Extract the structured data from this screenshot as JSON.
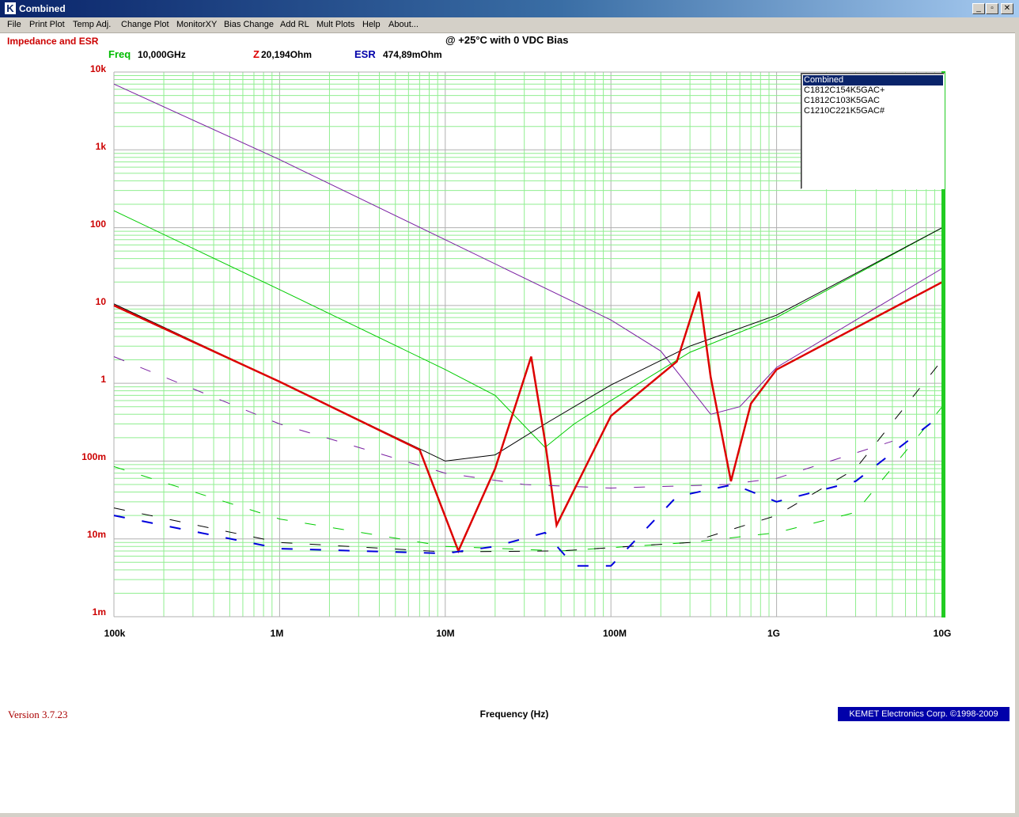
{
  "window": {
    "title": "Combined",
    "minimize": "_",
    "restore": "▫",
    "close": "✕"
  },
  "menu": [
    "File",
    "Print Plot",
    "Temp Adj.",
    "Change Plot",
    "MonitorXY",
    "Bias Change",
    "Add RL",
    "Mult Plots",
    "Help",
    "About..."
  ],
  "header": {
    "plot_title": "Impedance and ESR",
    "subtitle": "@ +25°C with 0 VDC Bias",
    "freq_label": "Freq",
    "freq_value": "10,000GHz",
    "z_label": "Z",
    "z_value": "20,194Ohm",
    "esr_label": "ESR",
    "esr_value": "474,89mOhm"
  },
  "legend": {
    "items": [
      "Combined",
      "C1812C154K5GAC+",
      "C1812C103K5GAC",
      "C1210C221K5GAC#"
    ],
    "selected": "Combined"
  },
  "footer": {
    "version": "Version 3.7.23",
    "copyright": "KEMET Electronics Corp. ©1998-2009"
  },
  "colors": {
    "combined": "#dd0000",
    "c154": "#7a1fa2",
    "c103": "#00cc00",
    "c221": "#000000",
    "esr_combined": "#0000dd",
    "grid": "#90ee90"
  },
  "chart_data": {
    "type": "line",
    "scale": "log-log",
    "title": "Impedance and ESR",
    "subtitle": "@ +25°C with 0 VDC Bias",
    "xlabel": "Frequency (Hz)",
    "ylabel": "",
    "xlim": [
      100000,
      10000000000
    ],
    "ylim": [
      0.001,
      10000
    ],
    "x_tick_labels": [
      "100k",
      "1M",
      "10M",
      "100M",
      "1G",
      "10G"
    ],
    "y_tick_labels": [
      "10k",
      "1k",
      "100",
      "10",
      "1",
      "100m",
      "10m",
      "1m"
    ],
    "grid": true,
    "legend_position": "top-right",
    "series": [
      {
        "name": "C1812C154K5GAC+",
        "kind": "impedance",
        "x": [
          100000,
          1000000,
          10000000,
          100000000,
          200000000,
          400000000,
          600000000,
          1000000000,
          10000000000
        ],
        "y": [
          7000,
          750,
          70,
          6.5,
          2.6,
          0.4,
          0.5,
          1.6,
          30
        ]
      },
      {
        "name": "C1812C103K5GAC",
        "kind": "impedance",
        "x": [
          100000,
          1000000,
          10000000,
          20000000,
          40000000,
          60000000,
          100000000,
          300000000,
          1000000000,
          10000000000
        ],
        "y": [
          165,
          16,
          1.5,
          0.7,
          0.15,
          0.3,
          0.6,
          2.5,
          7,
          100
        ]
      },
      {
        "name": "C1210C221K5GAC#",
        "kind": "impedance",
        "x": [
          100000,
          1000000,
          10000000,
          20000000,
          40000000,
          100000000,
          300000000,
          1000000000,
          10000000000
        ],
        "y": [
          10.5,
          1.05,
          0.1,
          0.12,
          0.3,
          0.95,
          3,
          7.5,
          100
        ]
      },
      {
        "name": "Combined",
        "kind": "impedance",
        "x": [
          100000,
          1000000,
          7000000,
          12000000,
          20000000,
          33000000,
          40000000,
          47000000,
          100000000,
          250000000,
          340000000,
          400000000,
          530000000,
          700000000,
          1000000000,
          10000000000
        ],
        "y": [
          10,
          1.05,
          0.14,
          0.007,
          0.08,
          2.2,
          0.18,
          0.015,
          0.38,
          1.9,
          15,
          1.2,
          0.055,
          0.55,
          1.5,
          20
        ]
      },
      {
        "name": "C1812C154K5GAC+ ESR",
        "kind": "esr",
        "x": [
          100000,
          1000000,
          10000000,
          30000000,
          100000000,
          500000000,
          1000000000,
          5000000000
        ],
        "y": [
          2.2,
          0.3,
          0.07,
          0.05,
          0.045,
          0.05,
          0.06,
          0.18
        ]
      },
      {
        "name": "C1812C103K5GAC ESR",
        "kind": "esr",
        "x": [
          100000,
          1000000,
          10000000,
          50000000,
          300000000,
          1000000000,
          3000000000,
          10000000000
        ],
        "y": [
          0.085,
          0.018,
          0.008,
          0.007,
          0.009,
          0.012,
          0.022,
          0.5
        ]
      },
      {
        "name": "C1210C221K5GAC# ESR",
        "kind": "esr",
        "x": [
          100000,
          1000000,
          10000000,
          50000000,
          300000000,
          1000000000,
          3000000000,
          10000000000
        ],
        "y": [
          0.025,
          0.009,
          0.0068,
          0.007,
          0.009,
          0.02,
          0.08,
          2
        ]
      },
      {
        "name": "Combined ESR",
        "kind": "esr",
        "x": [
          100000,
          1000000,
          10000000,
          20000000,
          40000000,
          60000000,
          100000000,
          250000000,
          550000000,
          1000000000,
          3000000000,
          10000000000
        ],
        "y": [
          0.02,
          0.0075,
          0.0065,
          0.008,
          0.012,
          0.0045,
          0.0045,
          0.035,
          0.05,
          0.03,
          0.055,
          0.4
        ]
      }
    ]
  }
}
